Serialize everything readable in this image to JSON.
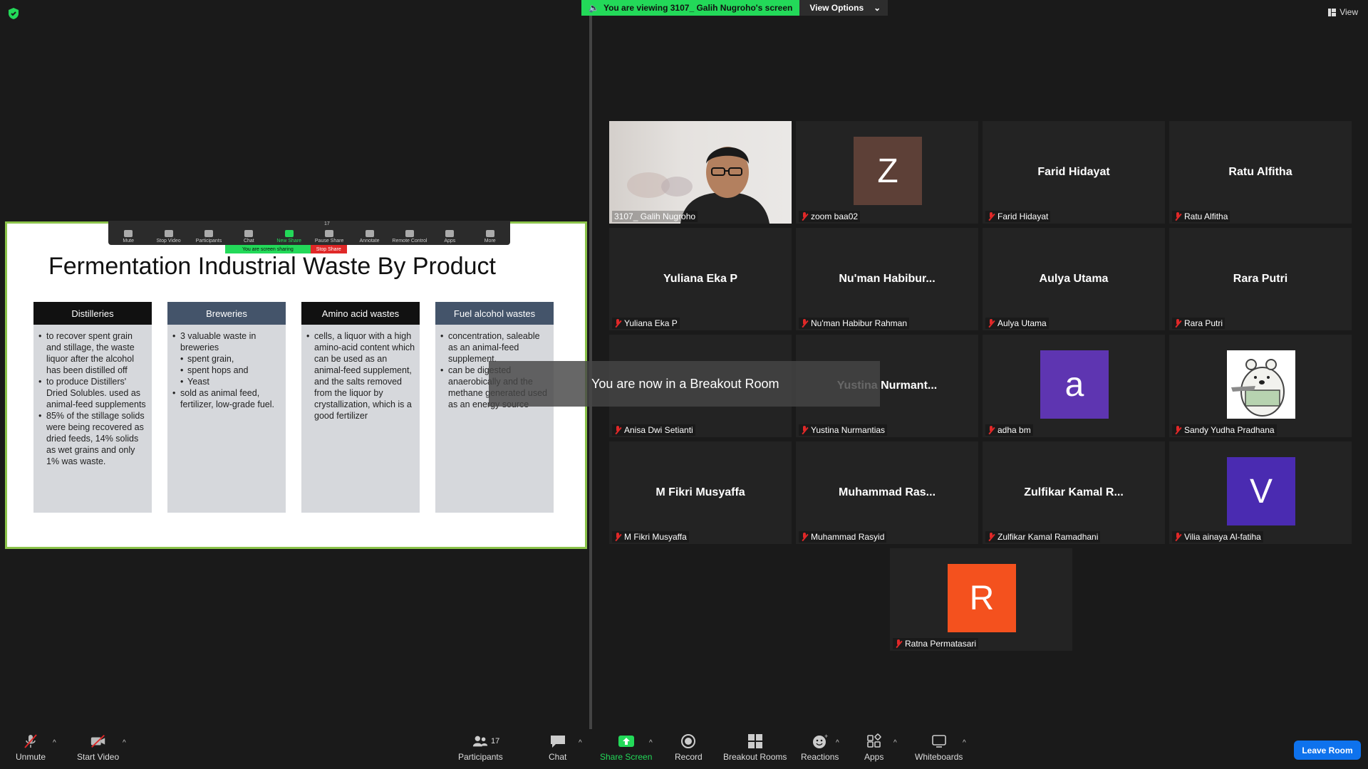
{
  "top": {
    "banner_text": "You are viewing 3107_ Galih Nugroho's screen",
    "view_options": "View Options",
    "view_label": "View"
  },
  "shared": {
    "toolbar": [
      "Mute",
      "Stop Video",
      "Participants",
      "Chat",
      "New Share",
      "Pause Share",
      "Annotate",
      "Remote Control",
      "Apps",
      "More"
    ],
    "participants_count": "17",
    "sharing_text": "You are screen sharing",
    "stop_share": "Stop Share",
    "slide_title": "Fermentation Industrial Waste By Product",
    "columns": [
      {
        "title": "Distilleries",
        "color": "#111111",
        "items": [
          "to recover spent grain and stillage, the waste liquor after the alcohol has been distilled off",
          "to produce Distillers' Dried Solubles. used as animal-feed supplements",
          "85% of the stillage solids were being recovered as dried feeds, 14% solids as wet grains and only 1% was waste."
        ]
      },
      {
        "title": "Breweries",
        "color": "#44546a",
        "items": [
          "3 valuable waste in breweries",
          "spent grain,",
          "spent hops and",
          "Yeast",
          "sold as animal feed, fertilizer, low-grade fuel."
        ]
      },
      {
        "title": "Amino acid wastes",
        "color": "#111111",
        "items": [
          "cells, a liquor with a high amino-acid content which can be used as an animal-feed supplement, and the salts removed from the liquor by crystallization, which is a good fertilizer"
        ]
      },
      {
        "title": "Fuel alcohol wastes",
        "color": "#44546a",
        "items": [
          "concentration, saleable as an animal-feed supplement.",
          "can be digested anaerobically and the methane generated used as an energy source"
        ]
      }
    ]
  },
  "toast": "You are now in a Breakout Room",
  "tiles": [
    {
      "display": "",
      "label": "3107_ Galih Nugroho",
      "type": "video"
    },
    {
      "display": "Z",
      "label": "zoom baa02",
      "type": "avatar",
      "color": "#5d4037"
    },
    {
      "display": "Farid Hidayat",
      "label": "Farid Hidayat",
      "type": "name"
    },
    {
      "display": "Ratu Alfitha",
      "label": "Ratu Alfitha",
      "type": "name"
    },
    {
      "display": "Yuliana Eka P",
      "label": "Yuliana Eka P",
      "type": "name"
    },
    {
      "display": "Nu'man  Habibur...",
      "label": "Nu'man Habibur Rahman",
      "type": "name"
    },
    {
      "display": "Aulya Utama",
      "label": "Aulya Utama",
      "type": "name"
    },
    {
      "display": "Rara Putri",
      "label": "Rara Putri",
      "type": "name"
    },
    {
      "display": "",
      "label": "Anisa Dwi Setianti",
      "type": "name"
    },
    {
      "display": "Yustina  Nurmant...",
      "label": "Yustina Nurmantias",
      "type": "name"
    },
    {
      "display": "a",
      "label": "adha bm",
      "type": "avatar",
      "color": "#5e35b1"
    },
    {
      "display": "",
      "label": "Sandy Yudha Pradhana",
      "type": "bear"
    },
    {
      "display": "M Fikri Musyaffa",
      "label": "M Fikri Musyaffa",
      "type": "name"
    },
    {
      "display": "Muhammad  Ras...",
      "label": "Muhammad Rasyid",
      "type": "name"
    },
    {
      "display": "Zulfikar  Kamal  R...",
      "label": "Zulfikar Kamal Ramadhani",
      "type": "name"
    },
    {
      "display": "V",
      "label": "Vilia ainaya Al-fatiha",
      "type": "avatar",
      "color": "#4a2bb1"
    },
    {
      "display": "R",
      "label": "Ratna Permatasari",
      "type": "avatar",
      "color": "#f4511e"
    }
  ],
  "bottom": {
    "unmute": "Unmute",
    "start_video": "Start Video",
    "participants": "Participants",
    "participants_count": "17",
    "chat": "Chat",
    "share_screen": "Share Screen",
    "record": "Record",
    "breakout_rooms": "Breakout Rooms",
    "reactions": "Reactions",
    "apps": "Apps",
    "whiteboards": "Whiteboards",
    "leave": "Leave Room"
  }
}
